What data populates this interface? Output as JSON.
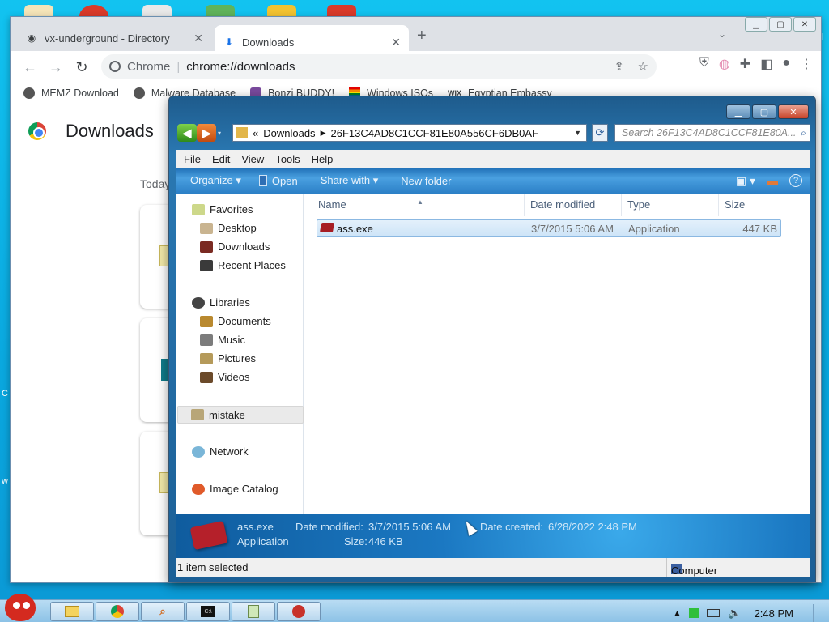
{
  "chrome": {
    "tabs": [
      {
        "label": "vx-underground - Directory",
        "icon": "globe-icon"
      },
      {
        "label": "Downloads",
        "icon": "download-icon"
      }
    ],
    "new_tab": "+",
    "omnibox": {
      "scheme": "Chrome",
      "url": "chrome://downloads"
    },
    "bookmarks": [
      "MEMZ Download",
      "Malware Database",
      "Bonzi BUDDY!",
      "Windows ISOs",
      "Egyptian Embassy"
    ],
    "page_title": "Downloads",
    "date_group": "Today"
  },
  "explorer": {
    "breadcrumb": {
      "prefix": "«",
      "parent": "Downloads",
      "folder": "26F13C4AD8C1CCF81E80A556CF6DB0AF"
    },
    "search_placeholder": "Search 26F13C4AD8C1CCF81E80A...",
    "menu": [
      "File",
      "Edit",
      "View",
      "Tools",
      "Help"
    ],
    "commands": {
      "organize": "Organize ▾",
      "open": "Open",
      "share": "Share with ▾",
      "new_folder": "New folder"
    },
    "nav": {
      "favorites": "Favorites",
      "desktop": "Desktop",
      "downloads": "Downloads",
      "recent": "Recent Places",
      "libraries": "Libraries",
      "documents": "Documents",
      "music": "Music",
      "pictures": "Pictures",
      "videos": "Videos",
      "mistake": "mistake",
      "network": "Network",
      "image_catalog": "Image Catalog"
    },
    "columns": {
      "name": "Name",
      "date": "Date modified",
      "type": "Type",
      "size": "Size"
    },
    "file": {
      "name": "ass.exe",
      "date": "3/7/2015 5:06 AM",
      "type": "Application",
      "size": "447 KB"
    },
    "details": {
      "name": "ass.exe",
      "type": "Application",
      "date_modified_label": "Date modified:",
      "date_modified": "3/7/2015 5:06 AM",
      "size_label": "Size:",
      "size": "446 KB",
      "date_created_label": "Date created:",
      "date_created": "6/28/2022 2:48 PM"
    },
    "status": {
      "selection": "1 item selected",
      "location": "Computer"
    }
  },
  "taskbar": {
    "time": "2:48 PM"
  },
  "colors": {
    "accent": "#1b78c2",
    "desktop": "#0ab4e8",
    "taskbar": "#a9d2ef",
    "exe_red": "#a61d24"
  }
}
